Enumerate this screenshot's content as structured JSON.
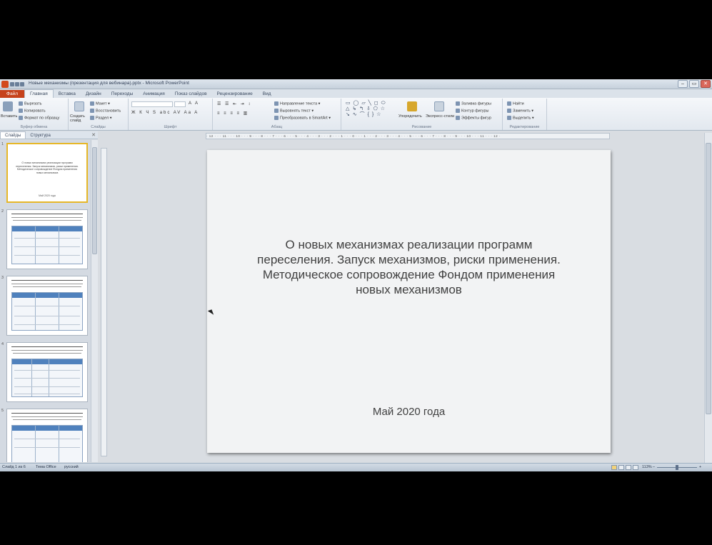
{
  "titlebar": {
    "title": "Новые механизмы (презентация для вебинара).pptx - Microsoft PowerPoint"
  },
  "tabs": [
    "Файл",
    "Главная",
    "Вставка",
    "Дизайн",
    "Переходы",
    "Анимация",
    "Показ слайдов",
    "Рецензирование",
    "Вид"
  ],
  "ribbon": {
    "clipboard": {
      "paste": "Вставить",
      "cut": "Вырезать",
      "copy": "Копировать",
      "format_painter": "Формат по образцу",
      "label": "Буфер обмена"
    },
    "slides": {
      "new_slide": "Создать слайд",
      "layout": "Макет",
      "reset": "Восстановить",
      "section": "Раздел",
      "label": "Слайды"
    },
    "font_label": "Шрифт",
    "paragraph": {
      "text_direction": "Направление текста",
      "align_text": "Выровнять текст",
      "smartart": "Преобразовать в SmartArt",
      "label": "Абзац"
    },
    "drawing": {
      "arrange": "Упорядочить",
      "quick_styles": "Экспресс-стили",
      "shape_fill": "Заливка фигуры",
      "shape_outline": "Контур фигуры",
      "shape_effects": "Эффекты фигур",
      "label": "Рисование"
    },
    "editing": {
      "find": "Найти",
      "replace": "Заменить",
      "select": "Выделить",
      "label": "Редактирование"
    }
  },
  "pane_tabs": [
    "Слайды",
    "Структура"
  ],
  "thumbnails": [
    {
      "number": "1",
      "text": "О новых механизмах реализации программ переселения. Запуск механизмов, риски применения. Методическое сопровождение Фондом применения новых механизмов",
      "date": "Май 2020 года"
    },
    {
      "number": "2"
    },
    {
      "number": "3"
    },
    {
      "number": "4"
    },
    {
      "number": "5"
    }
  ],
  "slide": {
    "title": "О новых механизмах реализации программ переселения. Запуск механизмов, риски применения. Методическое сопровождение Фондом применения новых механизмов",
    "date": "Май 2020 года"
  },
  "statusbar": {
    "slide_info": "Слайд 1 из 6",
    "theme": "Тема Office",
    "language": "русский",
    "zoom": "113%"
  }
}
